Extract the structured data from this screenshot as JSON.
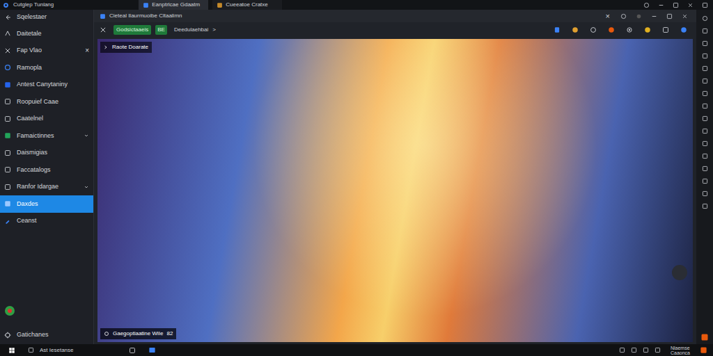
{
  "window": {
    "title": "Cutglep Tunlang"
  },
  "tabs": [
    {
      "label": "Eanptrlcae Gdaatm",
      "selected": true
    },
    {
      "label": "Cueeatoe Cratxe",
      "selected": false
    }
  ],
  "sidebar": {
    "back_label": "Sqelestaer",
    "items": [
      {
        "label": "Daitetale",
        "selected": false,
        "kind": "plain"
      },
      {
        "label": "Fap Vlao",
        "selected": false,
        "kind": "close",
        "trail": "×"
      },
      {
        "label": "Ramopla",
        "selected": false,
        "kind": "plain"
      },
      {
        "label": "Antest Canytaniny",
        "selected": false,
        "kind": "plain"
      },
      {
        "label": "Roopuief Caae",
        "selected": false,
        "kind": "plain"
      },
      {
        "label": "Caatelnel",
        "selected": false,
        "kind": "plain"
      },
      {
        "label": "Famaictinnes",
        "selected": false,
        "kind": "expand"
      },
      {
        "label": "Daismigias",
        "selected": false,
        "kind": "plain"
      },
      {
        "label": "Faccatalogs",
        "selected": false,
        "kind": "plain"
      },
      {
        "label": "Ranfor Idargae",
        "selected": false,
        "kind": "expand"
      },
      {
        "label": "Daxdes",
        "selected": true,
        "kind": "plain"
      },
      {
        "label": "Ceanst",
        "selected": false,
        "kind": "plain"
      }
    ],
    "footer": "Gatichanes"
  },
  "document": {
    "title": "Cieteal Ilaurmuoibe Cltaalimn",
    "close": "×",
    "badge": "Godsictaaeis",
    "badge_tag": "BE",
    "breadcrumb": "Deedulaehbai",
    "chevron": ">",
    "overlay_label": "Raote Doarate",
    "caption": "Gaegoptiaatine WiIe",
    "caption_count": "82"
  },
  "taskbar": {
    "search": "Ast Iesetanse",
    "tray": [
      "Nlaemse",
      "Caaonca"
    ]
  }
}
